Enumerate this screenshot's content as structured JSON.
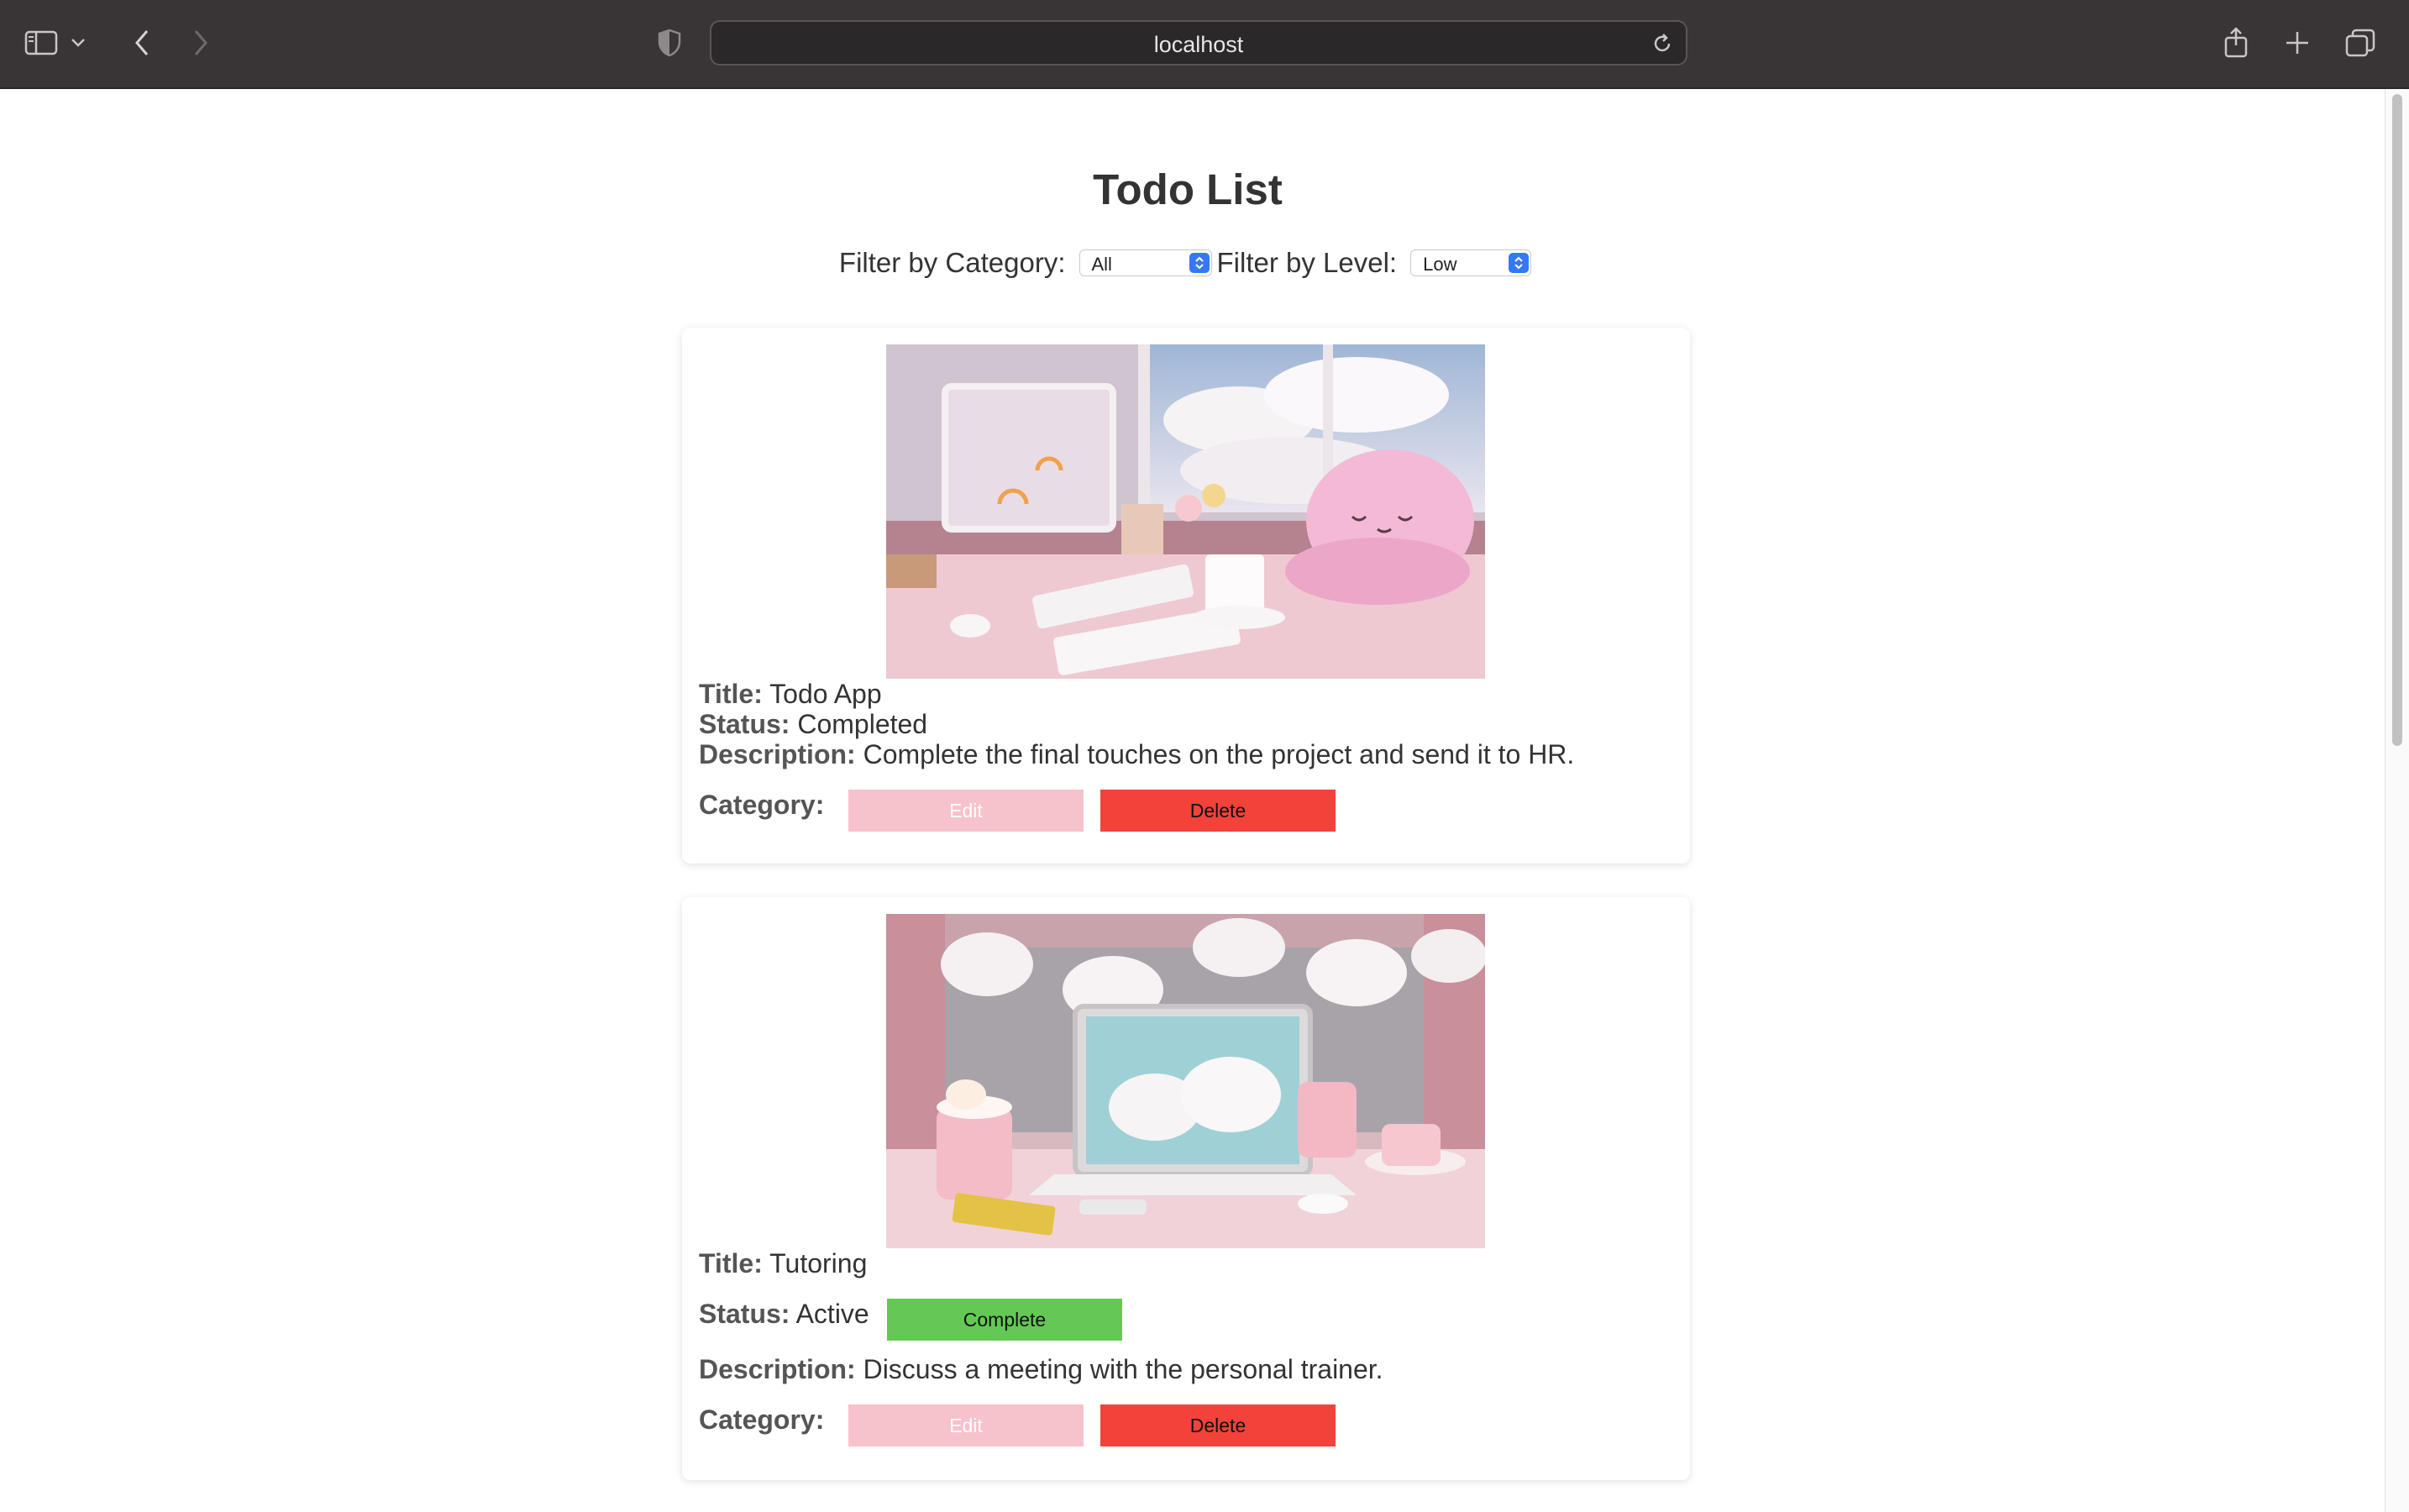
{
  "browser": {
    "url": "localhost"
  },
  "page": {
    "title": "Todo List",
    "filter_category_label": "Filter by Category:",
    "filter_category_value": "All",
    "filter_level_label": "Filter by Level:",
    "filter_level_value": "Low"
  },
  "labels": {
    "title": "Title:",
    "status": "Status:",
    "description": "Description:",
    "category": "Category:"
  },
  "todos": [
    {
      "title": "Todo App",
      "status": "Completed",
      "description": "Complete the final touches on the project and send it to HR.",
      "edit_label": "Edit",
      "delete_label": "Delete"
    },
    {
      "title": "Tutoring",
      "status": "Active",
      "complete_label": "Complete",
      "description": "Discuss a meeting with the personal trainer.",
      "edit_label": "Edit",
      "delete_label": "Delete"
    }
  ],
  "colors": {
    "edit_button": "#f6c2cc",
    "delete_button": "#f2423a",
    "complete_button": "#63c954",
    "chrome_bg": "#393536"
  }
}
